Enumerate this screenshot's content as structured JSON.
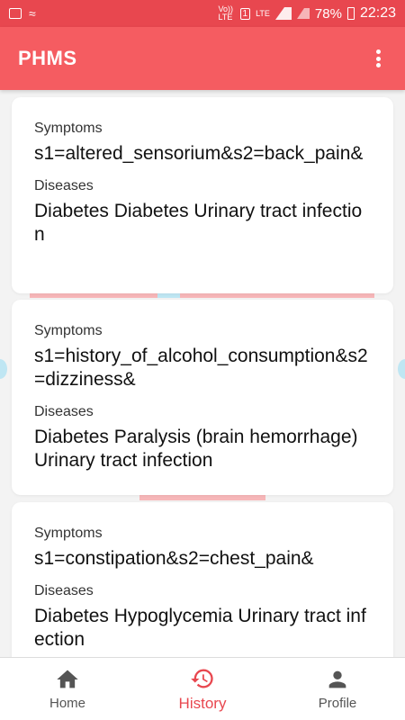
{
  "status_bar": {
    "volte": "Vo)) LTE",
    "sim": "1",
    "lte": "LTE",
    "battery": "78%",
    "time": "22:23"
  },
  "app_bar": {
    "title": "PHMS"
  },
  "history": [
    {
      "symptoms_label": "Symptoms",
      "symptoms": "s1=altered_sensorium&s2=back_pain&",
      "diseases_label": "Diseases",
      "diseases": "Diabetes Diabetes Urinary tract infection"
    },
    {
      "symptoms_label": "Symptoms",
      "symptoms": "s1=history_of_alcohol_consumption&s2=dizziness&",
      "diseases_label": "Diseases",
      "diseases": "Diabetes Paralysis (brain hemorrhage) Urinary tract infection"
    },
    {
      "symptoms_label": "Symptoms",
      "symptoms": "s1=constipation&s2=chest_pain&",
      "diseases_label": "Diseases",
      "diseases": "Diabetes Hypoglycemia Urinary tract infection"
    }
  ],
  "bottom_nav": {
    "home": "Home",
    "history": "History",
    "profile": "Profile",
    "active": "history"
  },
  "colors": {
    "primary": "#f55c61",
    "status_bar": "#e8474f",
    "accent": "#e8474f"
  }
}
